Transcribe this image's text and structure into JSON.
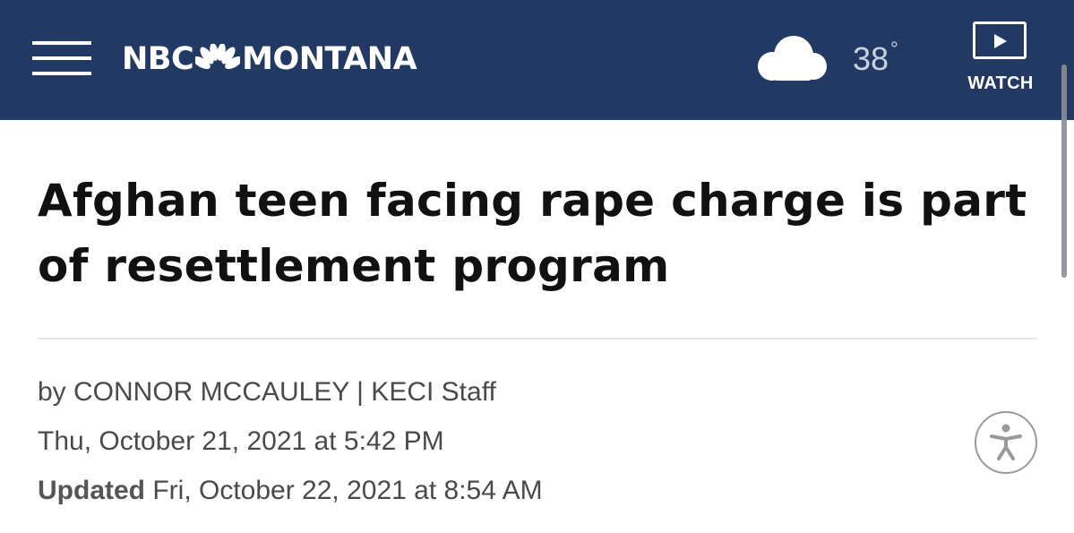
{
  "header": {
    "logo": {
      "left_text": "NBC",
      "right_text": "MONTANA"
    },
    "weather": {
      "temperature": "38",
      "degree_symbol": "°",
      "icon": "cloud-icon"
    },
    "watch": {
      "label": "WATCH",
      "icon": "play-icon"
    },
    "menu_icon": "hamburger-menu-icon"
  },
  "article": {
    "headline": "Afghan teen facing rape charge is part of resettlement program",
    "byline": "by CONNOR MCCAULEY | KECI Staff",
    "published": "Thu, October 21, 2021 at 5:42 PM",
    "updated_label": "Updated",
    "updated": "Fri, October 22, 2021 at 8:54 AM"
  },
  "accessibility": {
    "icon": "accessibility-icon"
  },
  "colors": {
    "header_bg": "#223a63",
    "headline_text": "#111111",
    "meta_text": "#4a4a4a"
  }
}
